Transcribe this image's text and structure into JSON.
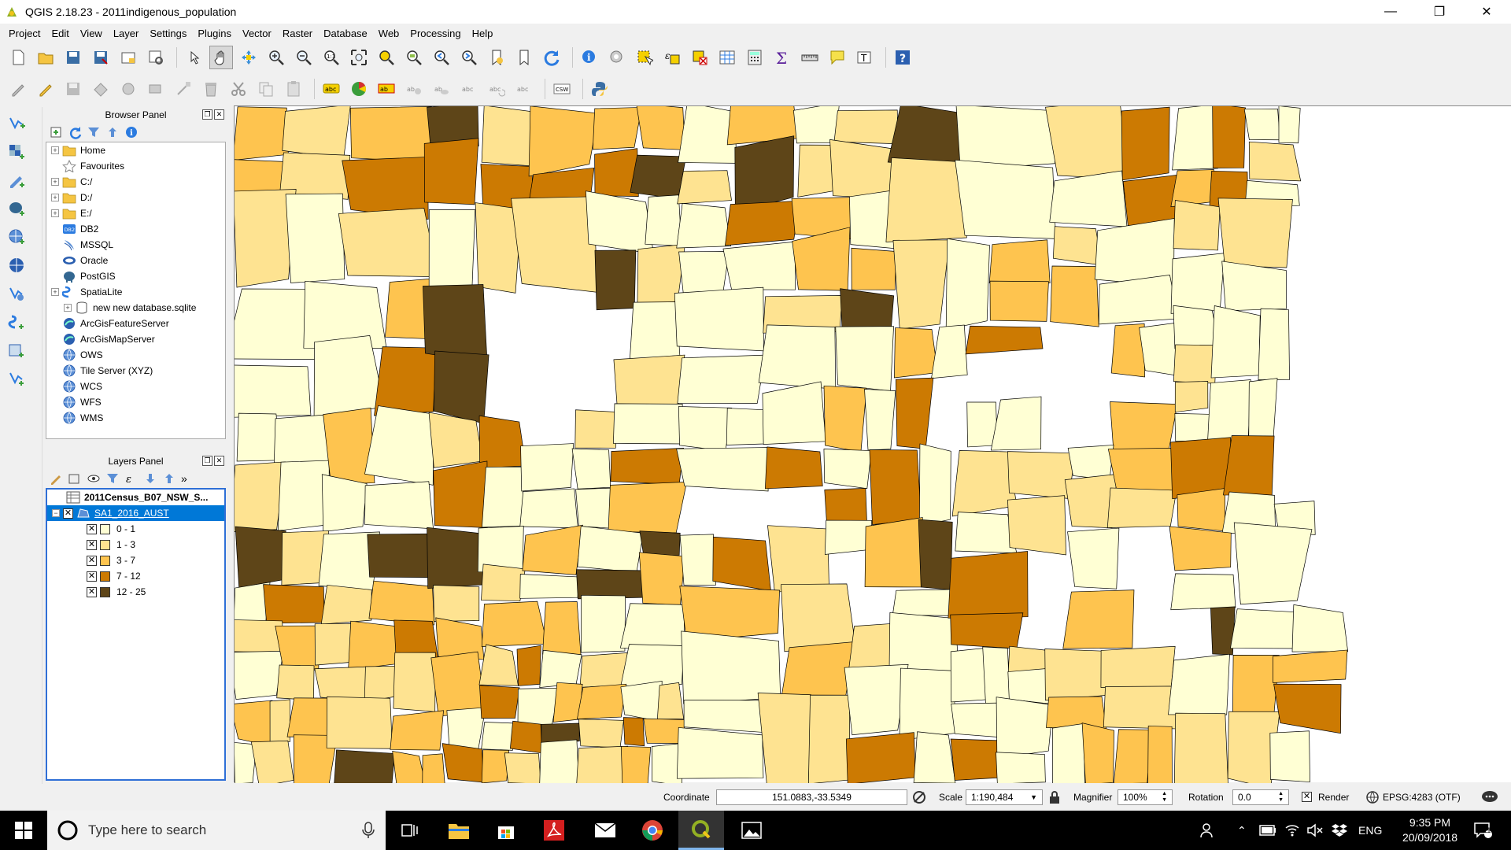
{
  "window": {
    "title": "QGIS 2.18.23 - 2011indigenous_population"
  },
  "menu": [
    "Project",
    "Edit",
    "View",
    "Layer",
    "Settings",
    "Plugins",
    "Vector",
    "Raster",
    "Database",
    "Web",
    "Processing",
    "Help"
  ],
  "browser": {
    "title": "Browser Panel",
    "items": [
      {
        "label": "Home",
        "icon": "folder-icon",
        "expandable": true
      },
      {
        "label": "Favourites",
        "icon": "star-icon",
        "expandable": false
      },
      {
        "label": "C:/",
        "icon": "folder-icon",
        "expandable": true
      },
      {
        "label": "D:/",
        "icon": "folder-icon",
        "expandable": true
      },
      {
        "label": "E:/",
        "icon": "folder-icon",
        "expandable": true
      },
      {
        "label": "DB2",
        "icon": "db2-icon",
        "expandable": false
      },
      {
        "label": "MSSQL",
        "icon": "mssql-icon",
        "expandable": false
      },
      {
        "label": "Oracle",
        "icon": "oracle-icon",
        "expandable": false
      },
      {
        "label": "PostGIS",
        "icon": "postgis-icon",
        "expandable": false
      },
      {
        "label": "SpatiaLite",
        "icon": "spatialite-icon",
        "expandable": true
      },
      {
        "label": "new new database.sqlite",
        "icon": "database-icon",
        "expandable": true,
        "indent": 1
      },
      {
        "label": "ArcGisFeatureServer",
        "icon": "arcgis-icon",
        "expandable": false
      },
      {
        "label": "ArcGisMapServer",
        "icon": "arcgis-icon",
        "expandable": false
      },
      {
        "label": "OWS",
        "icon": "globe-icon",
        "expandable": false
      },
      {
        "label": "Tile Server (XYZ)",
        "icon": "globe-icon",
        "expandable": false
      },
      {
        "label": "WCS",
        "icon": "globe-icon",
        "expandable": false
      },
      {
        "label": "WFS",
        "icon": "globe-icon",
        "expandable": false
      },
      {
        "label": "WMS",
        "icon": "globe-icon",
        "expandable": false
      }
    ]
  },
  "layers": {
    "title": "Layers Panel",
    "table_layer": "2011Census_B07_NSW_S...",
    "vector_layer": "SA1_2016_AUST",
    "legend": [
      {
        "label": "0 - 1",
        "color": "#ffffd4"
      },
      {
        "label": "1 - 3",
        "color": "#fee391"
      },
      {
        "label": "3 - 7",
        "color": "#fec44f"
      },
      {
        "label": "7 - 12",
        "color": "#cc7a02"
      },
      {
        "label": "12 - 25",
        "color": "#5e4518"
      }
    ]
  },
  "status": {
    "coordinate_label": "Coordinate",
    "coordinate_value": "151.0883,-33.5349",
    "scale_label": "Scale",
    "scale_value": "1:190,484",
    "magnifier_label": "Magnifier",
    "magnifier_value": "100%",
    "rotation_label": "Rotation",
    "rotation_value": "0.0",
    "render_label": "Render",
    "crs": "EPSG:4283 (OTF)"
  },
  "taskbar": {
    "search_placeholder": "Type here to search",
    "lang": "ENG",
    "time": "9:35 PM",
    "date": "20/09/2018",
    "notifications": "11"
  }
}
